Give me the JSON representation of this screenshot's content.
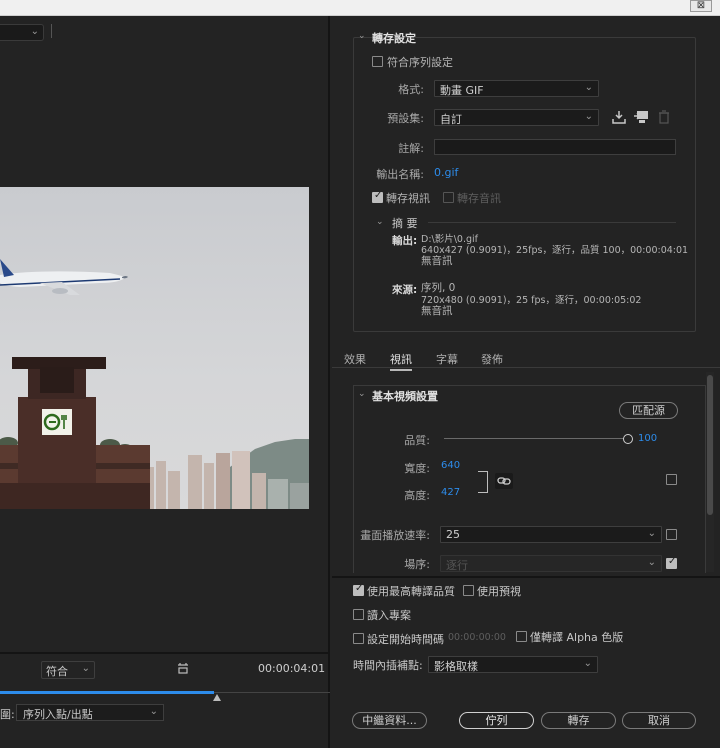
{
  "window": {
    "close_glyph": "⊠"
  },
  "preview": {
    "timecode": "00:00:04:01",
    "fit_label": "符合",
    "range_label_fragment": "圍:",
    "range_value": "序列入點/出點",
    "image_desc": "airplane-over-tower"
  },
  "export_settings": {
    "title": "轉存設定",
    "match_sequence_label": "符合序列設定",
    "format_label": "格式:",
    "format_value": "動畫 GIF",
    "preset_label": "預設集:",
    "preset_value": "自訂",
    "comment_label": "註解:",
    "output_name_label": "輸出名稱:",
    "output_name_value": "0.gif",
    "export_video_label": "轉存視訊",
    "export_audio_label": "轉存音訊"
  },
  "summary": {
    "title": "摘 要",
    "output_key": "輸出:",
    "output_line1": "D:\\影片\\0.gif",
    "output_line2": "640x427 (0.9091)，25fps，逐行，品質 100，00:00:04:01",
    "output_line3": "無音訊",
    "source_key": "來源:",
    "source_line1": "序列, 0",
    "source_line2": "720x480 (0.9091)，25 fps，逐行，00:00:05:02",
    "source_line3": "無音訊"
  },
  "tabs": [
    {
      "label": "效果"
    },
    {
      "label": "視訊"
    },
    {
      "label": "字幕"
    },
    {
      "label": "發佈"
    }
  ],
  "basic_video": {
    "title": "基本視頻設置",
    "match_source_button": "匹配源",
    "quality_label": "品質:",
    "quality_value": "100",
    "quality_fraction": 1.0,
    "width_label": "寬度:",
    "width_value": "640",
    "height_label": "高度:",
    "height_value": "427",
    "frame_rate_label": "畫面播放速率:",
    "frame_rate_value": "25",
    "field_order_label": "場序:",
    "field_order_value": "逐行"
  },
  "options": {
    "max_render_quality": "使用最高轉譯品質",
    "use_previews": "使用預視",
    "import_into_project": "讀入專案",
    "set_start_timecode": "設定開始時間碼",
    "start_timecode_value": "00:00:00:00",
    "render_alpha_only": "僅轉譯 Alpha 色版",
    "time_interpolation_label": "時間內插補點:",
    "time_interpolation_value": "影格取樣"
  },
  "buttons": {
    "metadata": "中繼資料...",
    "queue": "佇列",
    "export": "轉存",
    "cancel": "取消"
  },
  "colors": {
    "accent": "#2d8ceb",
    "panel_bg": "#232323",
    "title_bar": "#f0f0f0"
  }
}
